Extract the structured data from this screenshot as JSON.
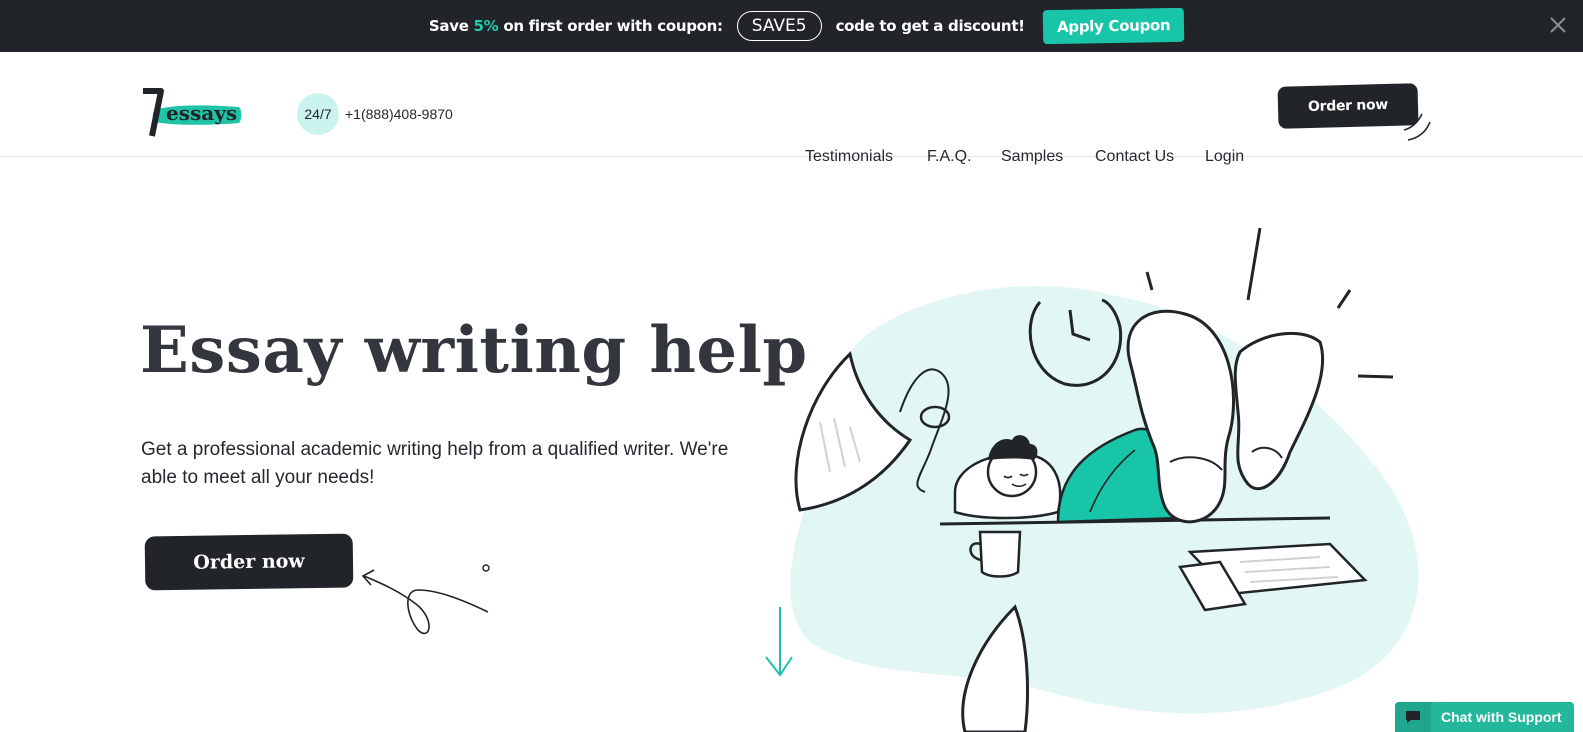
{
  "promo": {
    "text_before": "Save ",
    "percent": "5%",
    "text_after": " on first order with coupon:",
    "coupon_code": "SAVE5",
    "text_end": "code to get a discount!",
    "apply_label": "Apply Coupon",
    "close_icon": "close-icon"
  },
  "header": {
    "logo_number": "7",
    "logo_word": "essays",
    "support_badge": "24/7",
    "phone": "+1(888)408-9870",
    "nav": [
      "Testimonials",
      "F.A.Q.",
      "Samples",
      "Contact Us",
      "Login"
    ],
    "order_label": "Order now"
  },
  "hero": {
    "title": "Essay writing help",
    "subtitle": "Get a professional academic writing help from a qualified writer. We're able to meet all your needs!",
    "order_label": "Order now"
  },
  "chat": {
    "label": "Chat with Support",
    "icon": "chat-bubble-icon"
  },
  "colors": {
    "accent": "#18c5a8",
    "dark": "#212428",
    "light_mint": "#e2f7f3"
  }
}
